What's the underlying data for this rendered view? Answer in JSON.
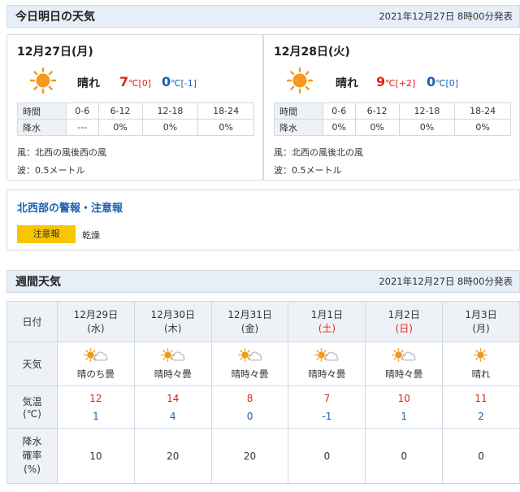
{
  "today_section": {
    "title": "今日明日の天気",
    "updated": "2021年12月27日 8時00分発表"
  },
  "days": [
    {
      "date": "12月27日(月)",
      "weather": "晴れ",
      "high": "7",
      "high_diff": "[0]",
      "low": "0",
      "low_diff": "[-1]",
      "temp_unit": "℃",
      "rain_row_labels": {
        "time": "時間",
        "rain": "降水"
      },
      "rain_times": [
        "0-6",
        "6-12",
        "12-18",
        "18-24"
      ],
      "rain_values": [
        "---",
        "0%",
        "0%",
        "0%"
      ],
      "wind": "風：北西の風後西の風",
      "wave": "波：0.5メートル"
    },
    {
      "date": "12月28日(火)",
      "weather": "晴れ",
      "high": "9",
      "high_diff": "[+2]",
      "low": "0",
      "low_diff": "[0]",
      "temp_unit": "℃",
      "rain_row_labels": {
        "time": "時間",
        "rain": "降水"
      },
      "rain_times": [
        "0-6",
        "6-12",
        "12-18",
        "18-24"
      ],
      "rain_values": [
        "0%",
        "0%",
        "0%",
        "0%"
      ],
      "wind": "風：北西の風後北の風",
      "wave": "波：0.5メートル"
    }
  ],
  "warning": {
    "title": "北西部の警報・注意報",
    "badge": "注意報",
    "text": "乾燥"
  },
  "weekly_section": {
    "title": "週間天気",
    "updated": "2021年12月27日 8時00分発表"
  },
  "weekly": {
    "row_labels": {
      "date": "日付",
      "weather": "天気",
      "temp": [
        "気温",
        "(℃)"
      ],
      "rain": [
        "降水",
        "確率",
        "(%)"
      ]
    },
    "days": [
      {
        "date": "12月29日",
        "dow": "(水)",
        "weather": "晴のち曇",
        "icon": "sun-then-cloud-icon",
        "high": "12",
        "low": "1",
        "rain": "10"
      },
      {
        "date": "12月30日",
        "dow": "(木)",
        "weather": "晴時々曇",
        "icon": "sun-cloud-icon",
        "high": "14",
        "low": "4",
        "rain": "20"
      },
      {
        "date": "12月31日",
        "dow": "(金)",
        "weather": "晴時々曇",
        "icon": "sun-cloud-icon",
        "high": "8",
        "low": "0",
        "rain": "20"
      },
      {
        "date": "1月1日",
        "dow": "(土)",
        "weather": "晴時々曇",
        "icon": "sun-cloud-icon",
        "high": "7",
        "low": "-1",
        "rain": "0"
      },
      {
        "date": "1月2日",
        "dow": "(日)",
        "weather": "晴時々曇",
        "icon": "sun-cloud-icon",
        "high": "10",
        "low": "1",
        "rain": "0"
      },
      {
        "date": "1月3日",
        "dow": "(月)",
        "weather": "晴れ",
        "icon": "sun-icon",
        "high": "11",
        "low": "2",
        "rain": "0"
      }
    ]
  },
  "colors": {
    "high": "#e2231a",
    "low": "#1a5fb4",
    "header_bg": "#e6eef8",
    "badge": "#f7c600",
    "sun": "#f39a1e"
  }
}
